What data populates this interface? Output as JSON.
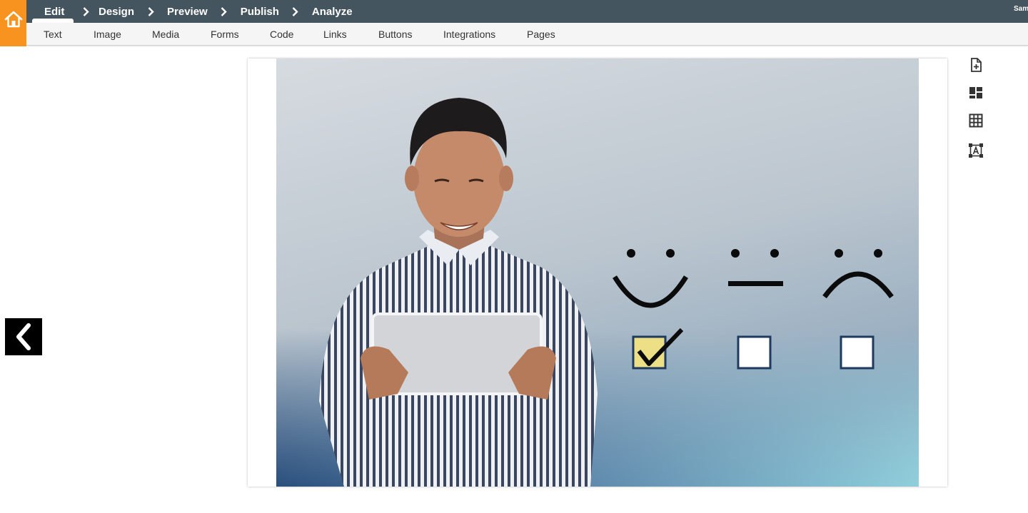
{
  "workflow": {
    "steps": [
      {
        "label": "Edit"
      },
      {
        "label": "Design"
      },
      {
        "label": "Preview"
      },
      {
        "label": "Publish"
      },
      {
        "label": "Analyze"
      }
    ],
    "user_label": "Sam"
  },
  "toolbar": {
    "items": [
      {
        "label": "Text"
      },
      {
        "label": "Image"
      },
      {
        "label": "Media"
      },
      {
        "label": "Forms"
      },
      {
        "label": "Code"
      },
      {
        "label": "Links"
      },
      {
        "label": "Buttons"
      },
      {
        "label": "Integrations"
      },
      {
        "label": "Pages"
      }
    ]
  },
  "rail": {
    "icons": [
      "add-page-icon",
      "layout-icon",
      "table-icon",
      "text-box-icon"
    ]
  },
  "colors": {
    "topbar": "#455560",
    "home_accent": "#f7931e",
    "checkbox_fill": "#ecdf86",
    "checkbox_border": "#1f3a5f"
  },
  "hero": {
    "feedback_options": [
      "happy-face-icon",
      "neutral-face-icon",
      "sad-face-icon"
    ],
    "selected_option": 0
  }
}
